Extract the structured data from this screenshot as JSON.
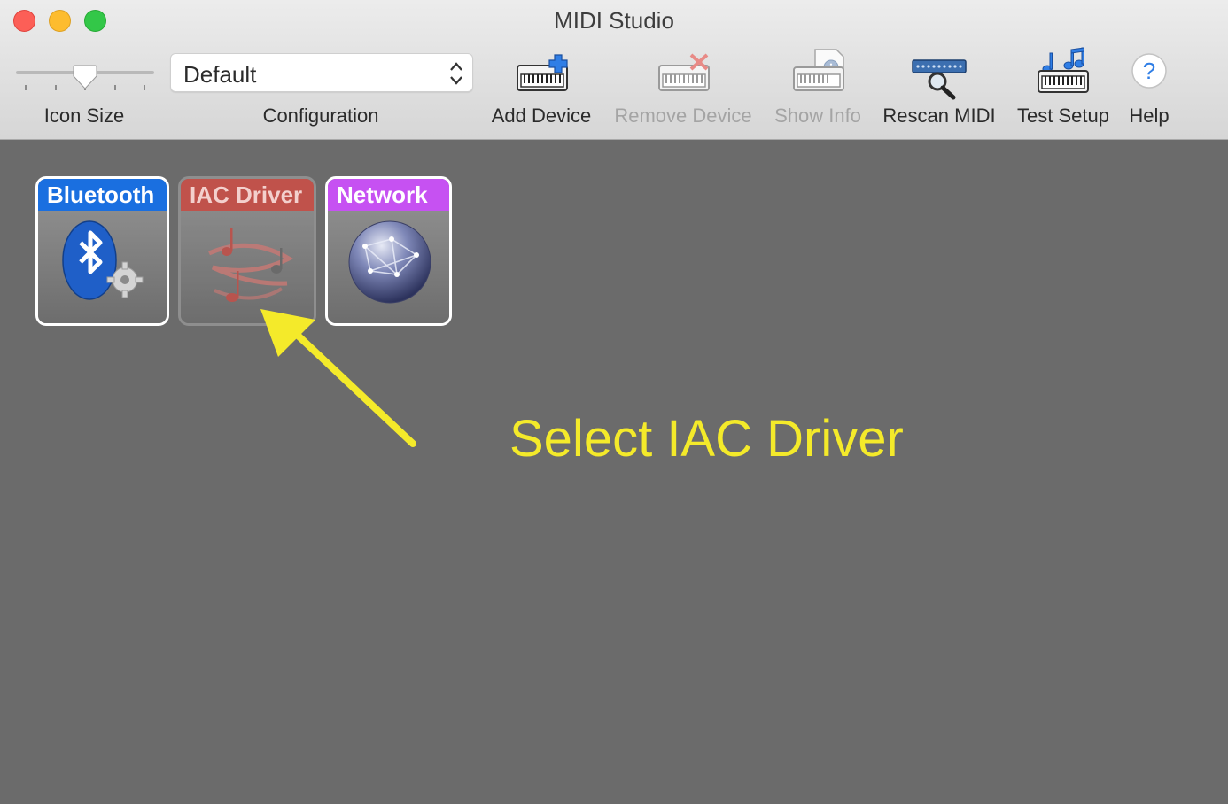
{
  "window": {
    "title": "MIDI Studio"
  },
  "toolbar": {
    "icon_size_label": "Icon Size",
    "configuration_label": "Configuration",
    "configuration_value": "Default",
    "add_device_label": "Add Device",
    "remove_device_label": "Remove Device",
    "show_info_label": "Show Info",
    "rescan_midi_label": "Rescan MIDI",
    "test_setup_label": "Test Setup",
    "help_label": "Help"
  },
  "devices": [
    {
      "name": "Bluetooth",
      "color": "#1a6fe0",
      "icon": "bluetooth-gear-icon",
      "selected": true
    },
    {
      "name": "IAC Driver",
      "color": "#c0524b",
      "icon": "music-notes-swirl-icon",
      "selected": false
    },
    {
      "name": "Network",
      "color": "#c651f2",
      "icon": "network-globe-icon",
      "selected": true
    }
  ],
  "annotation": {
    "text": "Select IAC Driver",
    "color": "#f4ea2a"
  },
  "colors": {
    "content_background": "#6b6b6b",
    "close": "#fc5f57",
    "minimize": "#fdbc2e",
    "maximize": "#33c748"
  }
}
